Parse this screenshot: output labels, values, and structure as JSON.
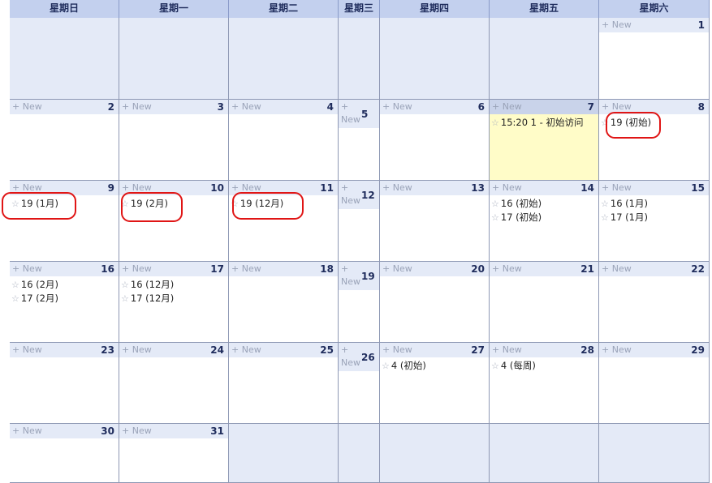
{
  "weekdays": [
    "星期日",
    "星期一",
    "星期二",
    "星期三",
    "星期四",
    "星期五",
    "星期六"
  ],
  "new_label": "+ New",
  "star_icon": "☆",
  "colors": {
    "header_bg": "#c3d0ee",
    "day_header_bg": "#e4eaf7",
    "today_bg": "#fffcc8",
    "annotation": "#e01515"
  },
  "weeks": [
    [
      null,
      null,
      null,
      null,
      null,
      null,
      {
        "day": "1",
        "events": []
      }
    ],
    [
      {
        "day": "2",
        "events": []
      },
      {
        "day": "3",
        "events": []
      },
      {
        "day": "4",
        "events": []
      },
      {
        "day": "5",
        "events": []
      },
      {
        "day": "6",
        "events": []
      },
      {
        "day": "7",
        "today": true,
        "events": [
          "15:20 1 - 初始访问"
        ]
      },
      {
        "day": "8",
        "events": [
          "19 (初始)"
        ]
      }
    ],
    [
      {
        "day": "9",
        "events": [
          "19 (1月)"
        ]
      },
      {
        "day": "10",
        "events": [
          "19 (2月)"
        ]
      },
      {
        "day": "11",
        "events": [
          "19 (12月)"
        ]
      },
      {
        "day": "12",
        "events": []
      },
      {
        "day": "13",
        "events": []
      },
      {
        "day": "14",
        "events": [
          "16 (初始)",
          "17 (初始)"
        ]
      },
      {
        "day": "15",
        "events": [
          "16 (1月)",
          "17 (1月)"
        ]
      }
    ],
    [
      {
        "day": "16",
        "events": [
          "16 (2月)",
          "17 (2月)"
        ]
      },
      {
        "day": "17",
        "events": [
          "16 (12月)",
          "17 (12月)"
        ]
      },
      {
        "day": "18",
        "events": []
      },
      {
        "day": "19",
        "events": []
      },
      {
        "day": "20",
        "events": []
      },
      {
        "day": "21",
        "events": []
      },
      {
        "day": "22",
        "events": []
      }
    ],
    [
      {
        "day": "23",
        "events": []
      },
      {
        "day": "24",
        "events": []
      },
      {
        "day": "25",
        "events": []
      },
      {
        "day": "26",
        "events": []
      },
      {
        "day": "27",
        "events": [
          "4 (初始)"
        ]
      },
      {
        "day": "28",
        "events": [
          "4 (每周)"
        ]
      },
      {
        "day": "29",
        "events": []
      }
    ],
    [
      {
        "day": "30",
        "events": []
      },
      {
        "day": "31",
        "events": []
      },
      null,
      null,
      null,
      null,
      null
    ]
  ]
}
